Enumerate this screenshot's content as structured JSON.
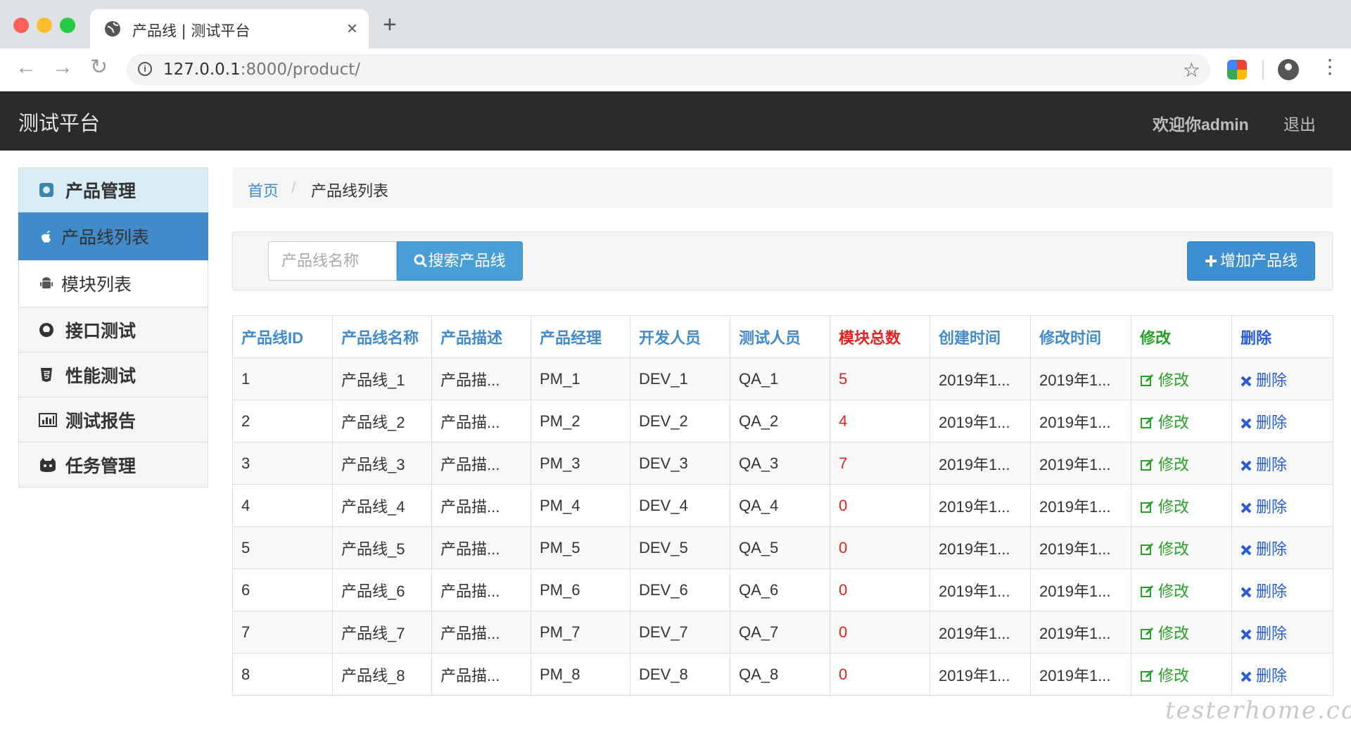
{
  "browser": {
    "tab_title": "产品线 | 测试平台",
    "url_host": "127.0.0.1",
    "url_rest": ":8000/product/"
  },
  "navbar": {
    "brand": "测试平台",
    "welcome": "欢迎你admin",
    "logout": "退出"
  },
  "sidebar": {
    "header": "产品管理",
    "items": [
      {
        "label": "产品线列表",
        "icon": "apple-icon"
      },
      {
        "label": "模块列表",
        "icon": "android-icon"
      },
      {
        "label": "接口测试",
        "icon": "github-icon"
      },
      {
        "label": "性能测试",
        "icon": "html5-icon"
      },
      {
        "label": "测试报告",
        "icon": "bar-chart-icon"
      },
      {
        "label": "任务管理",
        "icon": "mail-cat-icon"
      }
    ]
  },
  "breadcrumb": {
    "home": "首页",
    "separator": "/",
    "current": "产品线列表"
  },
  "search": {
    "placeholder": "产品线名称",
    "button_label": "搜索产品线",
    "add_label": "增加产品线"
  },
  "table": {
    "headers": [
      "产品线ID",
      "产品线名称",
      "产品描述",
      "产品经理",
      "开发人员",
      "测试人员",
      "模块总数",
      "创建时间",
      "修改时间",
      "修改",
      "删除"
    ],
    "rows": [
      [
        "1",
        "产品线_1",
        "产品描...",
        "PM_1",
        "DEV_1",
        "QA_1",
        "5",
        "2019年1...",
        "2019年1...",
        "修改",
        "删除"
      ],
      [
        "2",
        "产品线_2",
        "产品描...",
        "PM_2",
        "DEV_2",
        "QA_2",
        "4",
        "2019年1...",
        "2019年1...",
        "修改",
        "删除"
      ],
      [
        "3",
        "产品线_3",
        "产品描...",
        "PM_3",
        "DEV_3",
        "QA_3",
        "7",
        "2019年1...",
        "2019年1...",
        "修改",
        "删除"
      ],
      [
        "4",
        "产品线_4",
        "产品描...",
        "PM_4",
        "DEV_4",
        "QA_4",
        "0",
        "2019年1...",
        "2019年1...",
        "修改",
        "删除"
      ],
      [
        "5",
        "产品线_5",
        "产品描...",
        "PM_5",
        "DEV_5",
        "QA_5",
        "0",
        "2019年1...",
        "2019年1...",
        "修改",
        "删除"
      ],
      [
        "6",
        "产品线_6",
        "产品描...",
        "PM_6",
        "DEV_6",
        "QA_6",
        "0",
        "2019年1...",
        "2019年1...",
        "修改",
        "删除"
      ],
      [
        "7",
        "产品线_7",
        "产品描...",
        "PM_7",
        "DEV_7",
        "QA_7",
        "0",
        "2019年1...",
        "2019年1...",
        "修改",
        "删除"
      ],
      [
        "8",
        "产品线_8",
        "产品描...",
        "PM_8",
        "DEV_8",
        "QA_8",
        "0",
        "2019年1...",
        "2019年1...",
        "修改",
        "删除"
      ]
    ]
  },
  "watermark": "testerhome.com",
  "colors": {
    "navbar_bg": "#2b2b2b",
    "primary": "#428bca",
    "module_count": "#e52222",
    "edit": "#2aa02a",
    "delete": "#2a5bd7"
  }
}
